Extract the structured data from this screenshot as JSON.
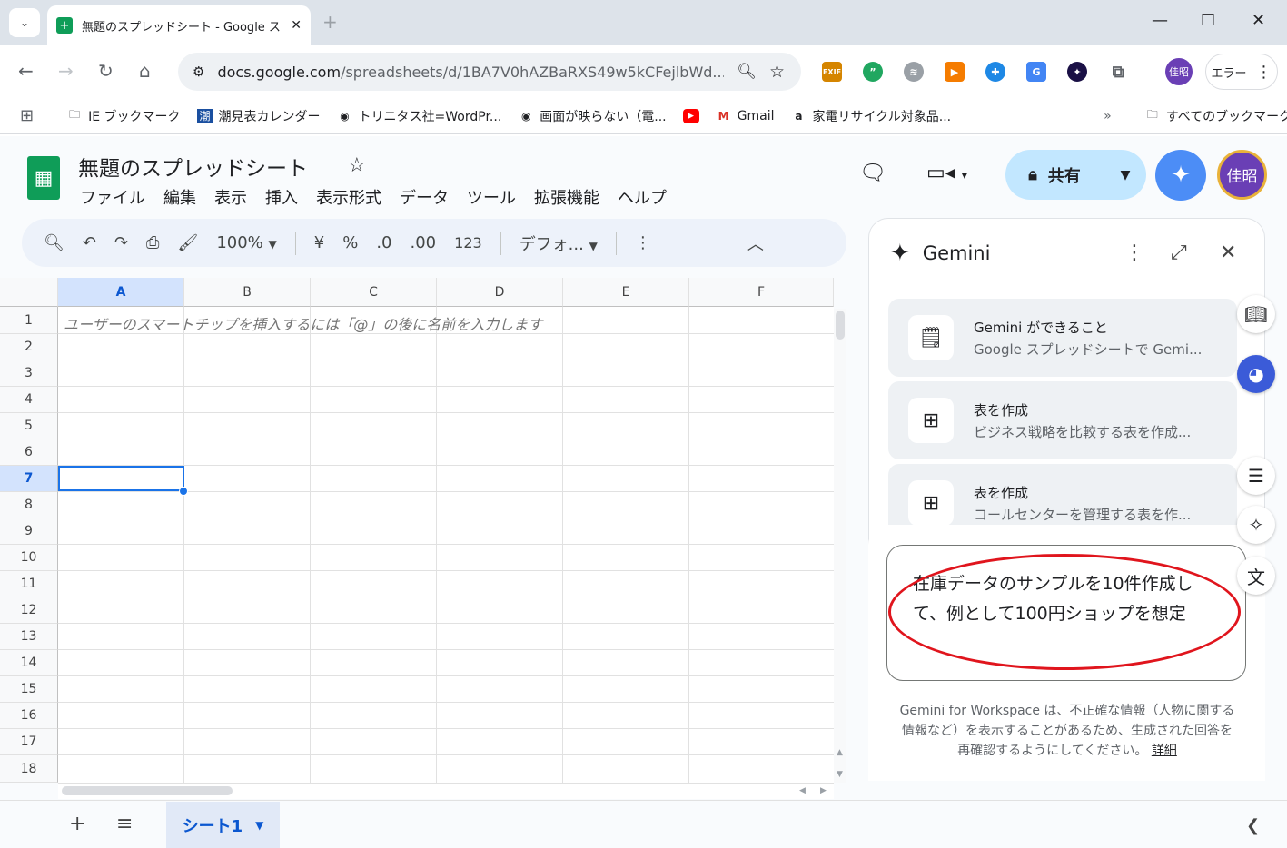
{
  "browser": {
    "tab_title": "無題のスプレッドシート - Google ス",
    "url_main": "docs.google.com",
    "url_path": "/spreadsheets/d/1BA7V0hAZBaRXS49w5kCFejlbWd...",
    "profile_initials": "佳昭",
    "error_label": "エラー",
    "bookmarks": [
      {
        "label": "IE ブックマーク"
      },
      {
        "label": "潮見表カレンダー"
      },
      {
        "label": "トリニタス社=WordPr..."
      },
      {
        "label": "画面が映らない（電..."
      },
      {
        "label": "Gmail"
      },
      {
        "label": "家電リサイクル対象品..."
      }
    ],
    "all_bookmarks": "すべてのブックマーク",
    "extensions": [
      "EXIF"
    ]
  },
  "sheets": {
    "title": "無題のスプレッドシート",
    "menu": [
      "ファイル",
      "編集",
      "表示",
      "挿入",
      "表示形式",
      "データ",
      "ツール",
      "拡張機能",
      "ヘルプ"
    ],
    "share_label": "共有",
    "avatar_initials": "佳昭",
    "toolbar": {
      "zoom": "100%",
      "currency": "¥",
      "percent": "%",
      "dec_decrease": ".0",
      "dec_increase": ".00",
      "number_format": "123",
      "font": "デフォ..."
    },
    "columns": [
      "A",
      "B",
      "C",
      "D",
      "E",
      "F"
    ],
    "rows": [
      "1",
      "2",
      "3",
      "4",
      "5",
      "6",
      "7",
      "8",
      "9",
      "10",
      "11",
      "12",
      "13",
      "14",
      "15",
      "16",
      "17",
      "18"
    ],
    "hint": "ユーザーのスマートチップを挿入するには「@」の後に名前を入力します",
    "selected_cell": "A7",
    "sheet_tab": "シート1"
  },
  "gemini": {
    "title": "Gemini",
    "cards": [
      {
        "title": "Gemini ができること",
        "subtitle": "Google スプレッドシートで Gemi..."
      },
      {
        "title": "表を作成",
        "subtitle": "ビジネス戦略を比較する表を作成..."
      },
      {
        "title": "表を作成",
        "subtitle": "コールセンターを管理する表を作..."
      }
    ],
    "prompt": "在庫データのサンプルを10件作成して、例として100円ショップを想定",
    "disclaimer": "Gemini for Workspace は、不正確な情報（人物に関する情報など）を表示することがあるため、生成された回答を再確認するようにしてください。",
    "details_link": "詳細"
  },
  "colors": {
    "accent": "#1a73e8",
    "sheets_green": "#0f9d58",
    "share_bg": "#c2e7ff",
    "annotation_red": "#e0151d"
  }
}
